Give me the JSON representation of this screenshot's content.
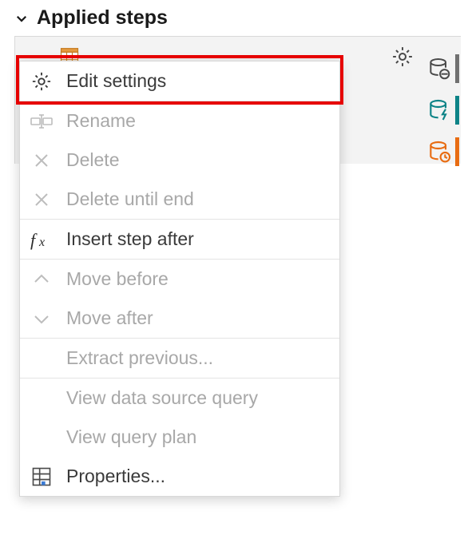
{
  "header": {
    "title": "Applied steps"
  },
  "menu": {
    "edit_settings": "Edit settings",
    "rename": "Rename",
    "delete": "Delete",
    "delete_until_end": "Delete until end",
    "insert_step_after": "Insert step after",
    "move_before": "Move before",
    "move_after": "Move after",
    "extract_previous": "Extract previous...",
    "view_data_source_query": "View data source query",
    "view_query_plan": "View query plan",
    "properties": "Properties..."
  }
}
